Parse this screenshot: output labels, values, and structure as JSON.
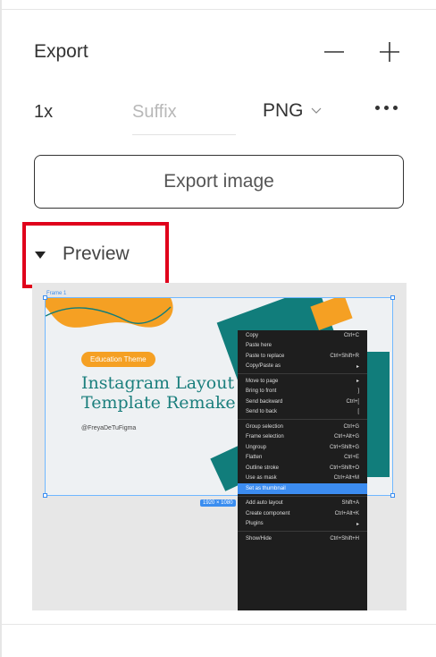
{
  "export": {
    "title": "Export",
    "scale": "1x",
    "suffix_placeholder": "Suffix",
    "format": "PNG",
    "export_button": "Export image"
  },
  "preview": {
    "label": "Preview",
    "frame_label": "Frame 1",
    "size_tag": "1920 × 1080",
    "thumbnail": {
      "badge": "Education Theme",
      "headline_line1": "Instagram Layout",
      "headline_line2": "Template Remake",
      "handle": "@FreyaDeTuFigma"
    },
    "context_menu": [
      {
        "label": "Copy",
        "shortcut": "Ctrl+C"
      },
      {
        "label": "Paste here",
        "shortcut": ""
      },
      {
        "label": "Paste to replace",
        "shortcut": "Ctrl+Shift+R"
      },
      {
        "label": "Copy/Paste as",
        "shortcut": "▸"
      },
      {
        "sep": true
      },
      {
        "label": "Move to page",
        "shortcut": "▸"
      },
      {
        "label": "Bring to front",
        "shortcut": "]"
      },
      {
        "label": "Send backward",
        "shortcut": "Ctrl+["
      },
      {
        "label": "Send to back",
        "shortcut": "["
      },
      {
        "sep": true
      },
      {
        "label": "Group selection",
        "shortcut": "Ctrl+G"
      },
      {
        "label": "Frame selection",
        "shortcut": "Ctrl+Alt+G"
      },
      {
        "label": "Ungroup",
        "shortcut": "Ctrl+Shift+G"
      },
      {
        "label": "Flatten",
        "shortcut": "Ctrl+E"
      },
      {
        "label": "Outline stroke",
        "shortcut": "Ctrl+Shift+O"
      },
      {
        "label": "Use as mask",
        "shortcut": "Ctrl+Alt+M"
      },
      {
        "label": "Set as thumbnail",
        "shortcut": "",
        "selected": true
      },
      {
        "sep": true
      },
      {
        "label": "Add auto layout",
        "shortcut": "Shift+A"
      },
      {
        "label": "Create component",
        "shortcut": "Ctrl+Alt+K"
      },
      {
        "label": "Plugins",
        "shortcut": "▸"
      },
      {
        "sep": true
      },
      {
        "label": "Show/Hide",
        "shortcut": "Ctrl+Shift+H"
      }
    ]
  },
  "colors": {
    "highlight": "#e0001b",
    "accent_teal": "#1b7f7d",
    "accent_orange": "#f5a023",
    "selection_blue": "#3a8df0"
  },
  "icons": {
    "remove": "minus-icon",
    "add": "plus-icon",
    "format_dropdown": "chevron-down-icon",
    "more": "more-horizontal-icon",
    "collapse": "triangle-down-icon"
  }
}
